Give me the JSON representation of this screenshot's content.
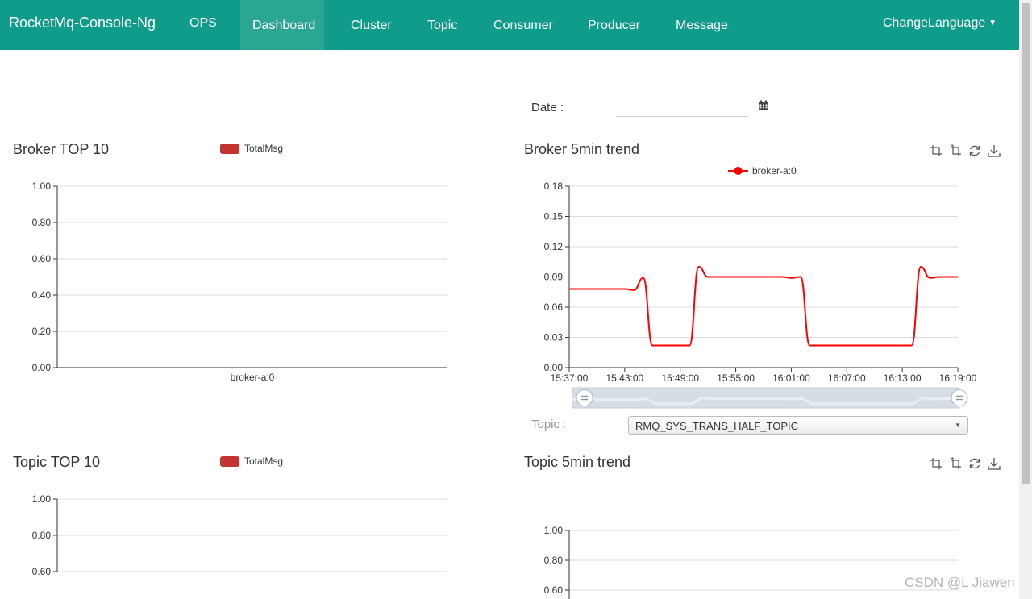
{
  "navbar": {
    "brand": "RocketMq-Console-Ng",
    "items": [
      {
        "label": "OPS",
        "active": false
      },
      {
        "label": "Dashboard",
        "active": true
      },
      {
        "label": "Cluster",
        "active": false
      },
      {
        "label": "Topic",
        "active": false
      },
      {
        "label": "Consumer",
        "active": false
      },
      {
        "label": "Producer",
        "active": false
      },
      {
        "label": "Message",
        "active": false
      }
    ],
    "change_language": "ChangeLanguage",
    "color": "#109c8b"
  },
  "date_picker": {
    "label": "Date :",
    "value": "",
    "icon": "calendar-icon"
  },
  "broker_top10": {
    "title": "Broker TOP 10",
    "legend": "TotalMsg"
  },
  "broker_trend": {
    "title": "Broker 5min trend",
    "legend": "broker-a:0",
    "toolbox": [
      "zoom-icon",
      "zoom-reset-icon",
      "restore-icon",
      "save-image-icon"
    ]
  },
  "topic_filter": {
    "label": "Topic :",
    "selected": "RMQ_SYS_TRANS_HALF_TOPIC"
  },
  "topic_top10": {
    "title": "Topic TOP 10",
    "legend": "TotalMsg"
  },
  "topic_trend": {
    "title": "Topic 5min trend",
    "toolbox": [
      "zoom-icon",
      "zoom-reset-icon",
      "restore-icon",
      "save-image-icon"
    ]
  },
  "watermark": "CSDN @L Jiawen",
  "chart_data": [
    {
      "type": "bar",
      "title": "Broker TOP 10",
      "categories": [
        "broker-a:0"
      ],
      "series": [
        {
          "name": "TotalMsg",
          "values": [
            0
          ]
        }
      ],
      "yticks": [
        "1.00",
        "0.80",
        "0.60",
        "0.40",
        "0.20",
        "0.00"
      ],
      "ylim": [
        0,
        1
      ],
      "grid": true,
      "legend_position": "top",
      "color": "#c23531"
    },
    {
      "type": "line",
      "title": "Broker 5min trend",
      "xticks": [
        "15:37:00",
        "15:43:00",
        "15:49:00",
        "15:55:00",
        "16:01:00",
        "16:07:00",
        "16:13:00",
        "16:19:00"
      ],
      "yticks": [
        "0.18",
        "0.15",
        "0.12",
        "0.09",
        "0.06",
        "0.03",
        "0.00"
      ],
      "ylim": [
        0,
        0.18
      ],
      "x": [
        "15:37:00",
        "15:39:00",
        "15:41:00",
        "15:43:00",
        "15:44:00",
        "15:45:00",
        "15:46:00",
        "15:47:00",
        "15:48:00",
        "15:49:00",
        "15:50:00",
        "15:51:00",
        "15:52:00",
        "15:53:00",
        "15:55:00",
        "15:58:00",
        "16:00:00",
        "16:01:00",
        "16:02:00",
        "16:03:00",
        "16:05:00",
        "16:08:00",
        "16:11:00",
        "16:13:00",
        "16:14:00",
        "16:15:00",
        "16:16:00",
        "16:17:00",
        "16:19:00"
      ],
      "series": [
        {
          "name": "broker-a:0",
          "values": [
            0.078,
            0.078,
            0.078,
            0.078,
            0.077,
            0.089,
            0.022,
            0.022,
            0.022,
            0.022,
            0.022,
            0.1,
            0.09,
            0.09,
            0.09,
            0.09,
            0.09,
            0.089,
            0.09,
            0.022,
            0.022,
            0.022,
            0.022,
            0.022,
            0.022,
            0.1,
            0.089,
            0.09,
            0.09
          ]
        }
      ],
      "grid": true,
      "legend_position": "top",
      "color": "#ff0000",
      "datazoom": true
    },
    {
      "type": "bar",
      "title": "Topic TOP 10",
      "categories": [],
      "series": [
        {
          "name": "TotalMsg",
          "values": []
        }
      ],
      "yticks": [
        "1.00",
        "0.80",
        "0.60"
      ],
      "ylim": [
        0,
        1
      ],
      "grid": true,
      "legend_position": "top",
      "color": "#c23531"
    },
    {
      "type": "line",
      "title": "Topic 5min trend",
      "yticks": [
        "1.00",
        "0.80",
        "0.60"
      ],
      "ylim": [
        0,
        1
      ],
      "series": [],
      "grid": true
    }
  ]
}
